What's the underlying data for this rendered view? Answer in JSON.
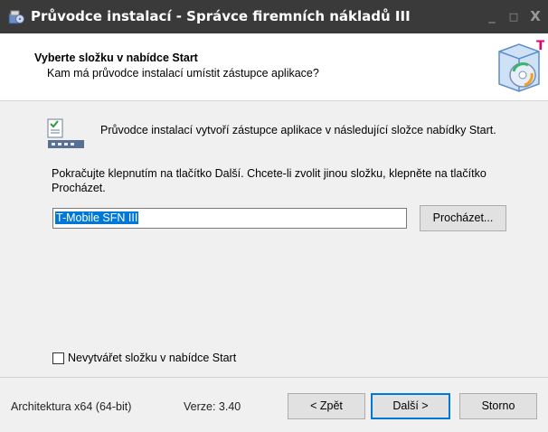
{
  "window": {
    "title": "Průvodce instalací - Správce firemních nákladů III",
    "controls": {
      "minimize": "_",
      "maximize": "□",
      "close": "X"
    }
  },
  "header": {
    "title": "Vyberte složku v nabídce Start",
    "subtitle": "Kam má průvodce instalací umístit zástupce aplikace?"
  },
  "content": {
    "intro": "Průvodce instalací vytvoří zástupce aplikace v následující složce nabídky Start.",
    "instruction": "Pokračujte klepnutím na tlačítko Další. Chcete-li zvolit jinou složku, klepněte na tlačítko Procházet.",
    "folder_value": "T-Mobile SFN III",
    "browse_label": "Procházet...",
    "no_folder_checkbox": {
      "label": "Nevytvářet složku v nabídce Start",
      "checked": false
    }
  },
  "footer": {
    "architecture": "Architektura x64 (64-bit)",
    "version": "Verze: 3.40",
    "back_label": "< Zpět",
    "next_label": "Další >",
    "cancel_label": "Storno"
  },
  "colors": {
    "titlebar": "#3a3a3a",
    "selection": "#0078d7",
    "brand_magenta": "#e20074"
  }
}
